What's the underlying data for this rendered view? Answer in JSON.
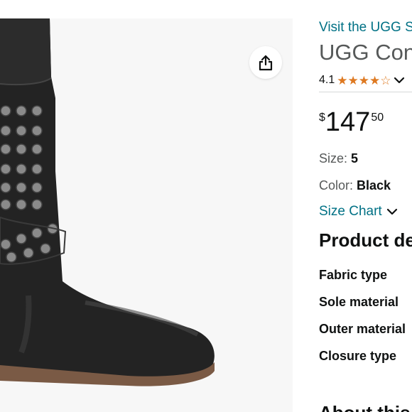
{
  "product_image": {
    "alt": "black leather mid-calf boot with metal studs",
    "share_icon": "share-icon"
  },
  "details": {
    "store_link": "Visit the UGG Store",
    "title": "UGG Conor",
    "rating": {
      "value": "4.1",
      "stars_filled": 4.1,
      "stars_total": 5,
      "dropdown_icon": "chevron-down-icon"
    },
    "price": {
      "symbol": "$",
      "whole": "147",
      "fraction": "50"
    },
    "size": {
      "label": "Size: ",
      "value": "5"
    },
    "color": {
      "label": "Color: ",
      "value": "Black"
    },
    "size_chart": {
      "label": "Size Chart",
      "icon": "chevron-down-icon"
    },
    "product_details": {
      "heading": "Product details",
      "rows": [
        {
          "label": "Fabric type"
        },
        {
          "label": "Sole material"
        },
        {
          "label": "Outer material"
        },
        {
          "label": "Closure type"
        }
      ]
    },
    "about_heading": "About this item"
  },
  "colors": {
    "link": "#007185",
    "star": "#de7921",
    "text": "#0f1111",
    "muted": "#565959"
  }
}
